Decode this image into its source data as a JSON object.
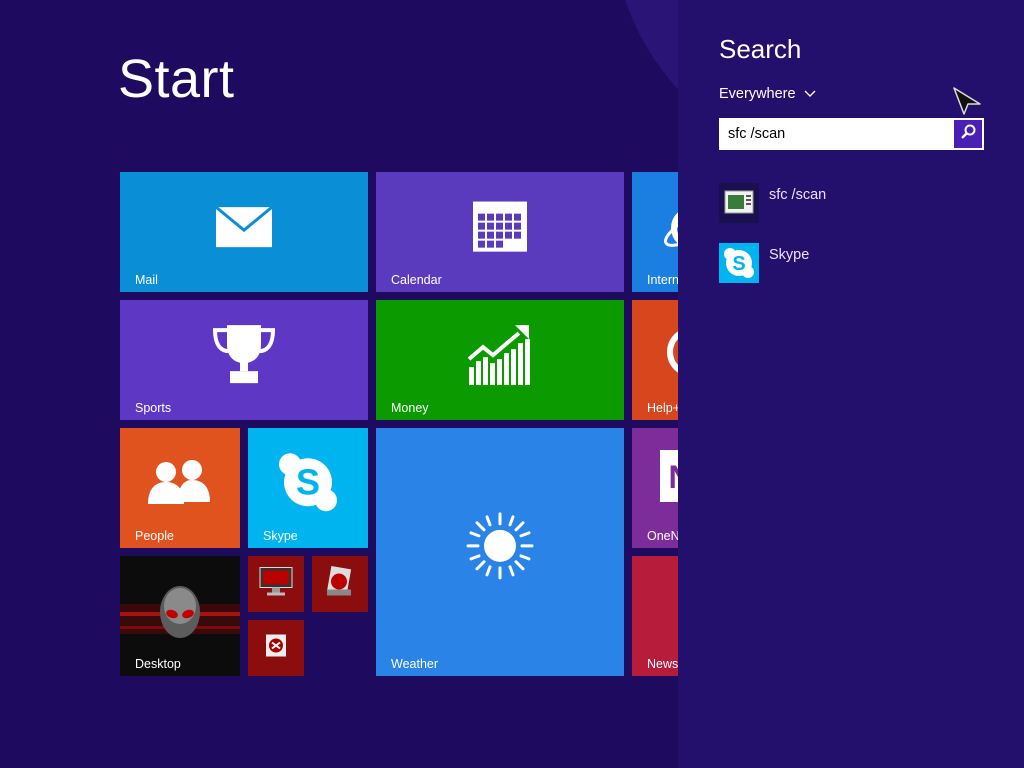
{
  "start": {
    "title": "Start",
    "tiles": {
      "mail": "Mail",
      "calendar": "Calendar",
      "internet": "Intern",
      "sports": "Sports",
      "money": "Money",
      "help": "Help+",
      "people": "People",
      "skype": "Skype",
      "weather": "Weather",
      "onenote": "OneN",
      "desktop": "Desktop",
      "news": "News"
    }
  },
  "search": {
    "title": "Search",
    "scope": "Everywhere",
    "query": "sfc /scan",
    "results": [
      {
        "label": "sfc /scan",
        "icon": "console-icon"
      },
      {
        "label": "Skype",
        "icon": "skype-icon"
      }
    ]
  },
  "colors": {
    "background": "#1e0a5e",
    "search_pane": "#230f6c",
    "mail": "#0a8fd6",
    "calendar": "#5b3bbd",
    "sports": "#5e38c4",
    "money": "#0b9a00",
    "people": "#e0531f",
    "skype": "#00b4f0",
    "weather": "#2a84e8",
    "news": "#b71c3b"
  }
}
